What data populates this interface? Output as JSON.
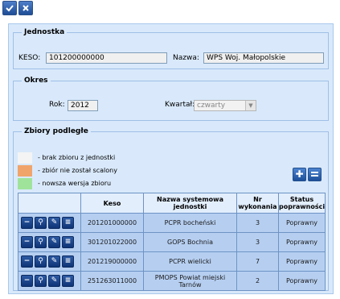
{
  "toolbar": {
    "confirm_icon": "checkmark-icon",
    "close_icon": "close-icon"
  },
  "jednostka": {
    "legend": "Jednostka",
    "keso_label": "KESO:",
    "keso_value": "101200000000",
    "nazwa_label": "Nazwa:",
    "nazwa_value": "WPS Woj. Małopolskie"
  },
  "okres": {
    "legend": "Okres",
    "rok_label": "Rok:",
    "rok_value": "2012",
    "kwartal_label": "Kwartał:",
    "kwartal_value": "czwarty"
  },
  "zbiory": {
    "legend": "Zbiory podległe",
    "legend_items": [
      {
        "color": "#f4f4f4",
        "text": "- brak zbioru z jednostki"
      },
      {
        "color": "#f0a46a",
        "text": "- zbiór nie został scalony"
      },
      {
        "color": "#9fe39b",
        "text": "- nowsza wersja zbioru"
      }
    ],
    "columns": [
      "Keso",
      "Nazwa systemowa jednostki",
      "Nr wykonania",
      "Status poprawności"
    ],
    "rows": [
      {
        "keso": "201201000000",
        "nazwa": "PCPR bocheński",
        "nr": "3",
        "status": "Poprawny"
      },
      {
        "keso": "301201022000",
        "nazwa": "GOPS Bochnia",
        "nr": "3",
        "status": "Poprawny"
      },
      {
        "keso": "201219000000",
        "nazwa": "PCPR wielicki",
        "nr": "7",
        "status": "Poprawny"
      },
      {
        "keso": "251263011000",
        "nazwa": "PMOPS Powiat miejski Tarnów",
        "nr": "2",
        "status": "Poprawny"
      }
    ]
  }
}
